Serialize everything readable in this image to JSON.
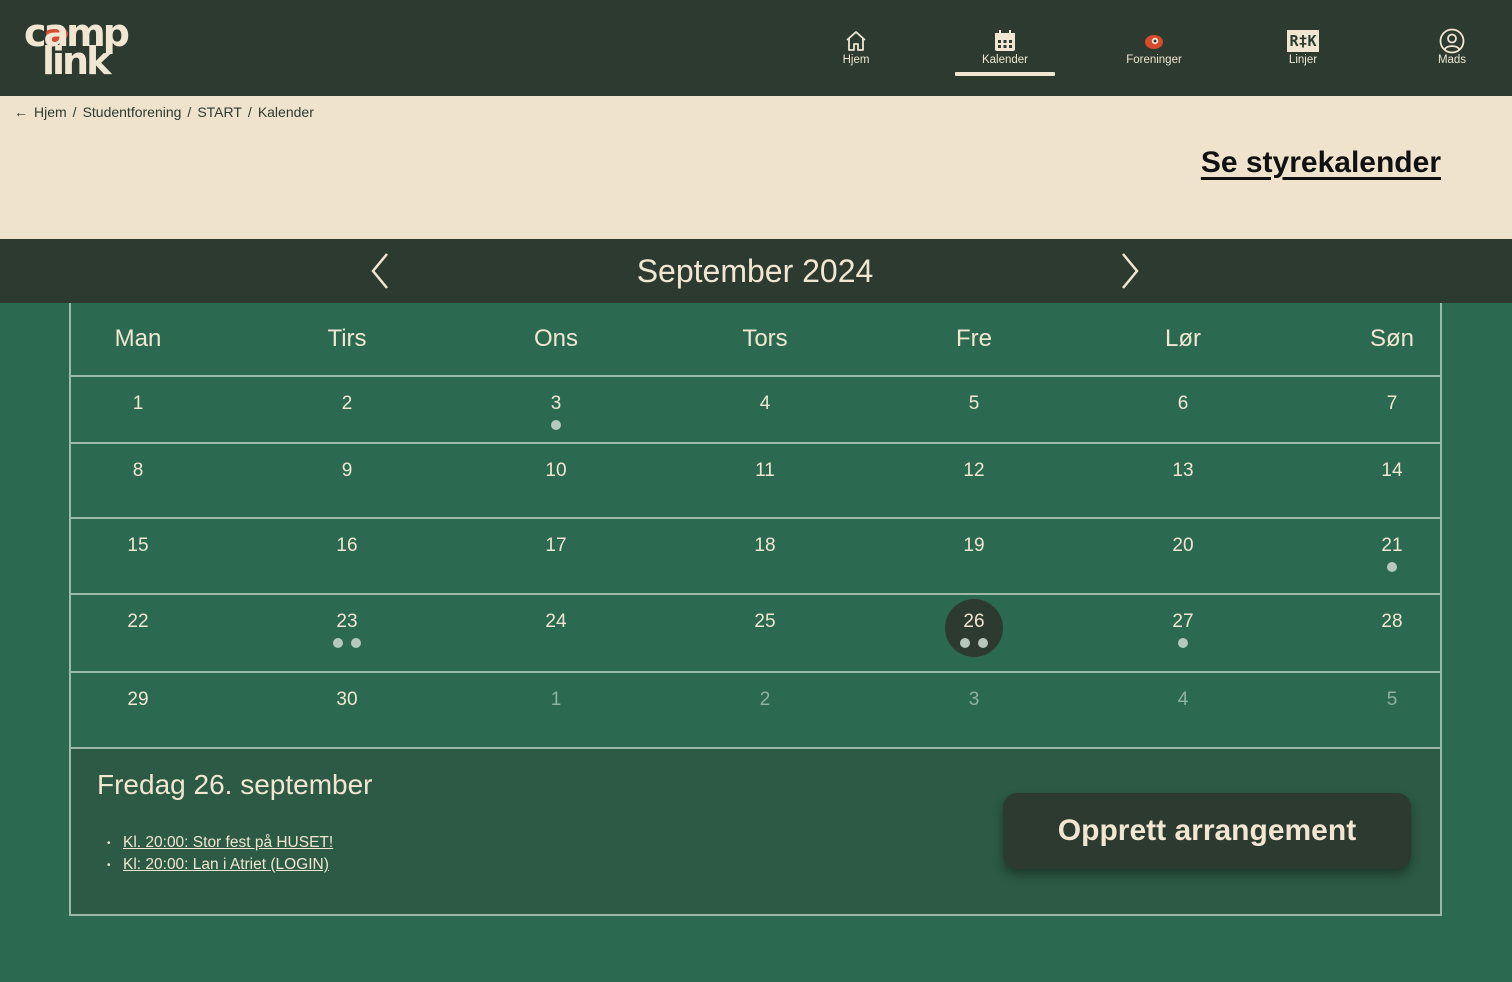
{
  "nav": {
    "logo_line1": "camp",
    "logo_line2": "link",
    "items": [
      {
        "label": "Hjem",
        "icon": "home-icon"
      },
      {
        "label": "Kalender",
        "icon": "calendar-icon",
        "active": true
      },
      {
        "label": "Foreninger",
        "icon": "foreninger-icon"
      },
      {
        "label": "Linjer",
        "icon": "linjer-icon",
        "icon_text": "R‡K"
      },
      {
        "label": "Mads",
        "icon": "user-icon"
      }
    ]
  },
  "breadcrumb": {
    "items": [
      "Hjem",
      "Studentforening",
      "START",
      "Kalender"
    ],
    "separator": "/"
  },
  "styre_link": "Se styrekalender",
  "calendar": {
    "month_title": "September 2024",
    "weekdays": [
      "Man",
      "Tirs",
      "Ons",
      "Tors",
      "Fre",
      "Lør",
      "Søn"
    ],
    "weeks": [
      [
        {
          "d": "1"
        },
        {
          "d": "2"
        },
        {
          "d": "3",
          "dots": 1
        },
        {
          "d": "4"
        },
        {
          "d": "5"
        },
        {
          "d": "6"
        },
        {
          "d": "7"
        }
      ],
      [
        {
          "d": "8"
        },
        {
          "d": "9"
        },
        {
          "d": "10"
        },
        {
          "d": "11"
        },
        {
          "d": "12"
        },
        {
          "d": "13"
        },
        {
          "d": "14"
        }
      ],
      [
        {
          "d": "15"
        },
        {
          "d": "16"
        },
        {
          "d": "17"
        },
        {
          "d": "18"
        },
        {
          "d": "19"
        },
        {
          "d": "20"
        },
        {
          "d": "21",
          "dots": 1
        }
      ],
      [
        {
          "d": "22"
        },
        {
          "d": "23",
          "dots": 2
        },
        {
          "d": "24"
        },
        {
          "d": "25"
        },
        {
          "d": "26",
          "dots": 2,
          "selected": true
        },
        {
          "d": "27",
          "dots": 1
        },
        {
          "d": "28"
        }
      ],
      [
        {
          "d": "29"
        },
        {
          "d": "30"
        },
        {
          "d": "1",
          "other": true
        },
        {
          "d": "2",
          "other": true
        },
        {
          "d": "3",
          "other": true
        },
        {
          "d": "4",
          "other": true
        },
        {
          "d": "5",
          "other": true
        }
      ]
    ]
  },
  "details": {
    "title": "Fredag 26. september",
    "events": [
      "Kl. 20:00: Stor fest på HUSET!",
      "Kl: 20:00: Lan i Atriet (LOGIN)"
    ],
    "create_button": "Opprett arrangement"
  },
  "colors": {
    "dark": "#2d3a30",
    "green": "#2b6a50",
    "beige": "#efe3cd",
    "accent_red": "#d84a2e"
  }
}
